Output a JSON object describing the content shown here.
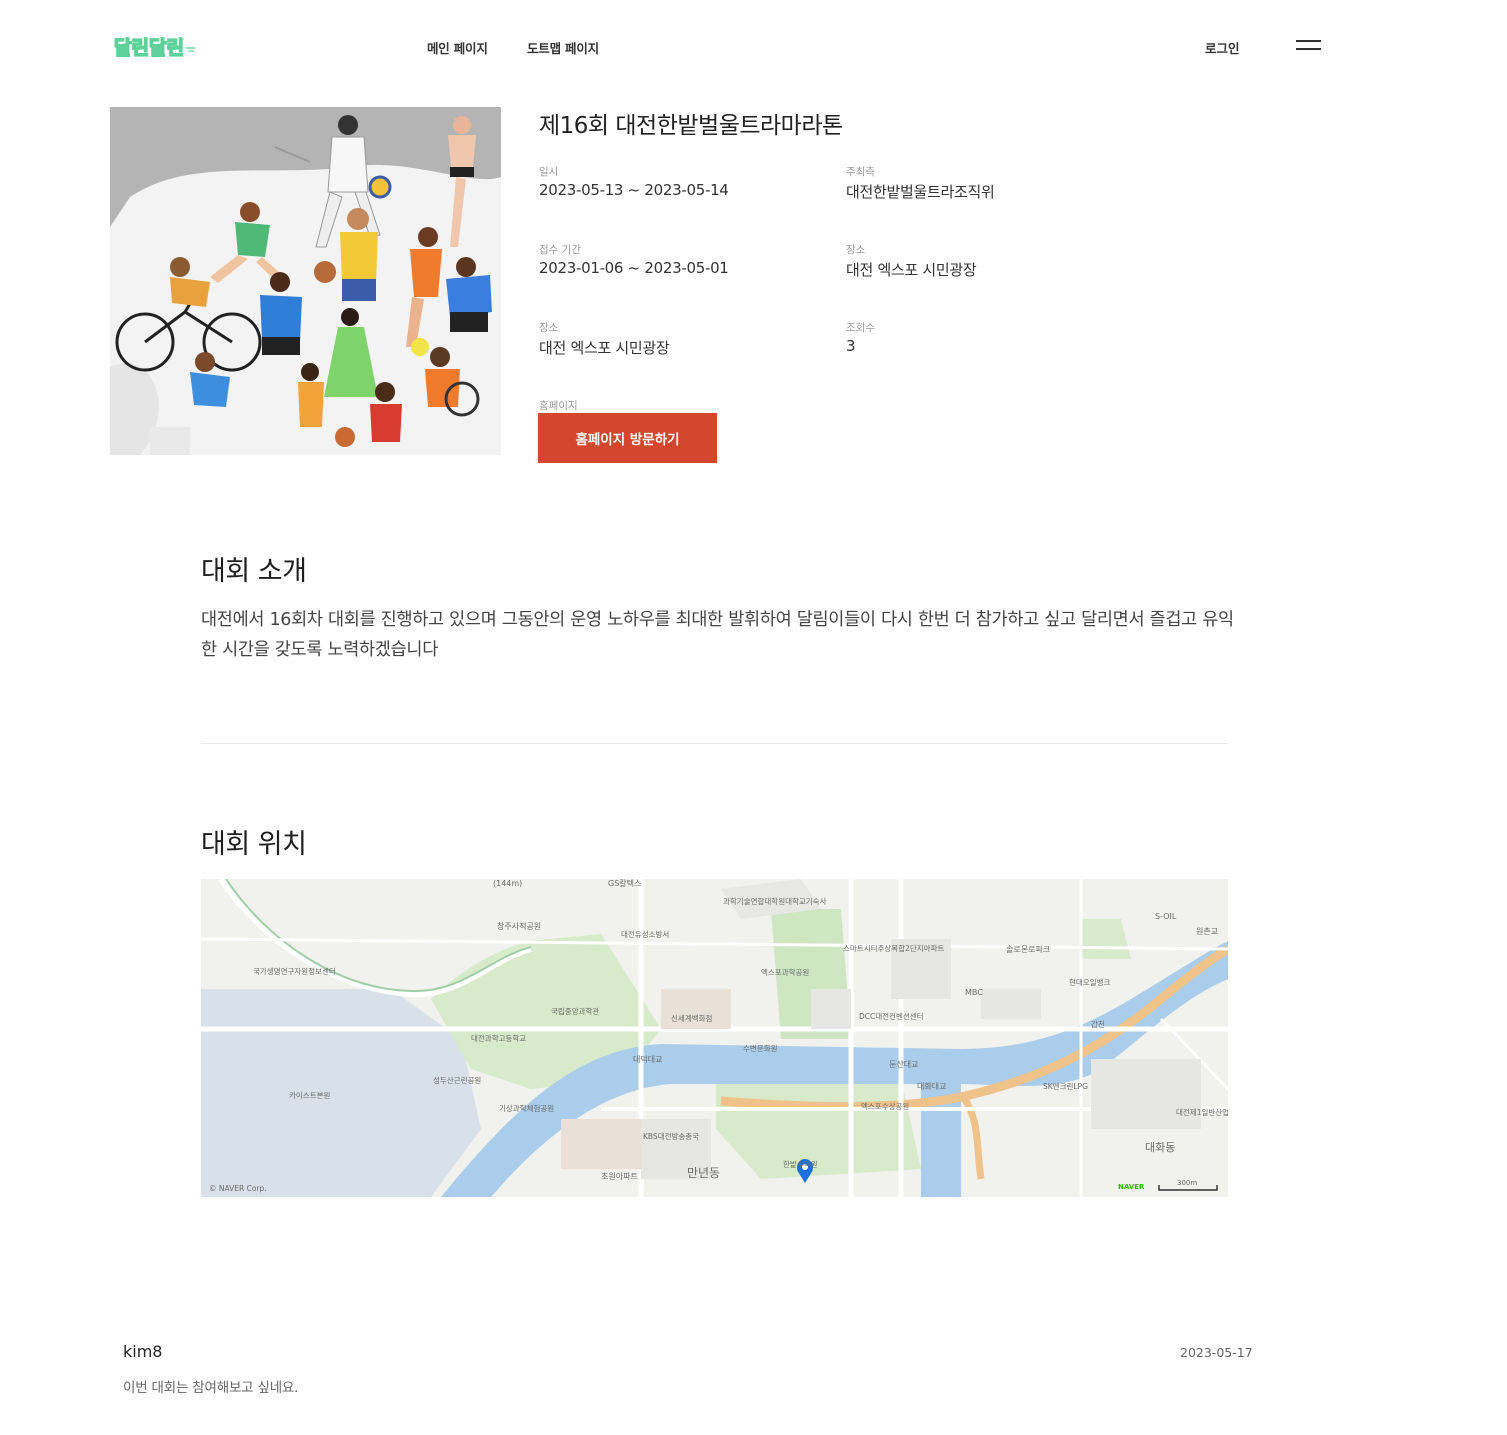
{
  "header": {
    "logo_text": "달린달린",
    "nav": [
      "메인 페이지",
      "도트맵 페이지"
    ],
    "login_label": "로그인"
  },
  "event": {
    "title": "제16회 대전한밭벌울트라마라톤",
    "fields": [
      {
        "label": "일시",
        "value": "2023-05-13 ~ 2023-05-14"
      },
      {
        "label": "주최측",
        "value": "대전한밭벌울트라조직위"
      },
      {
        "label": "접수 기간",
        "value": "2023-01-06 ~ 2023-05-01"
      },
      {
        "label": "장소",
        "value": "대전 엑스포 시민광장"
      },
      {
        "label": "장소",
        "value": "대전 엑스포 시민광장"
      },
      {
        "label": "조회수",
        "value": "3"
      }
    ],
    "homepage_label": "홈페이지",
    "visit_button": "홈페이지 방문하기"
  },
  "intro": {
    "heading": "대회 소개",
    "text": "대전에서 16회차 대회를 진행하고 있으며 그동안의 운영 노하우를 최대한 발휘하여 달림이들이 다시 한번 더 참가하고 싶고 달리면서 즐겁고 유익한 시간을 갖도록 노력하겠습니다"
  },
  "location": {
    "heading": "대회 위치",
    "map_labels": {
      "elevation": "(144m)",
      "gs": "GS칼텍스",
      "kaist_ac": "과학기술연합대학원대학교기숙사",
      "smart": "스마트시티주상복합2단지아파트",
      "soil": "S-OIL",
      "wonchon": "원촌교",
      "hwaam": "화암사",
      "chamju": "창주사적공원",
      "daejeon_police": "대전유성소방서",
      "gukga": "국가생명연구자원정보센터",
      "solron": "솔로몬로파크",
      "expo_park": "엑스포과학공원",
      "mbc": "MBC",
      "hyundai": "현대오일뱅크",
      "science_museum": "국립중앙과학관",
      "shinsegae": "신세계백화점",
      "dcc": "DCC대전컨벤션센터",
      "gap": "갑천",
      "daejeon_sci_hs": "대전과학고등학교",
      "subit": "수변문화원",
      "daedeok_bridge": "대덕대교",
      "dunsan_bridge": "둔산대교",
      "daehwa_bridge": "대화대교",
      "kaist": "카이스트본원",
      "seongdu": "성두산근린공원",
      "gisang": "기상과학체험공원",
      "kbs": "KBS대전방송총국",
      "expo_water": "엑스포수상공원",
      "sk": "SK엔크린LPG",
      "industrial": "대전제1일반산업단지",
      "daehwa": "대화동",
      "chowon": "초원아파트",
      "manyeon": "만년동",
      "hanbat": "한밭수목원",
      "naver_corp": "© NAVER Corp.",
      "naver": "NAVER",
      "scale": "300m"
    }
  },
  "comment": {
    "user": "kim8",
    "date": "2023-05-17",
    "text": "이번 대회는 참여해보고 싶네요."
  },
  "colors": {
    "accent": "#d4462d",
    "logo": "#5ed19a",
    "river": "#a9cdea",
    "park": "#cfe6c2"
  }
}
